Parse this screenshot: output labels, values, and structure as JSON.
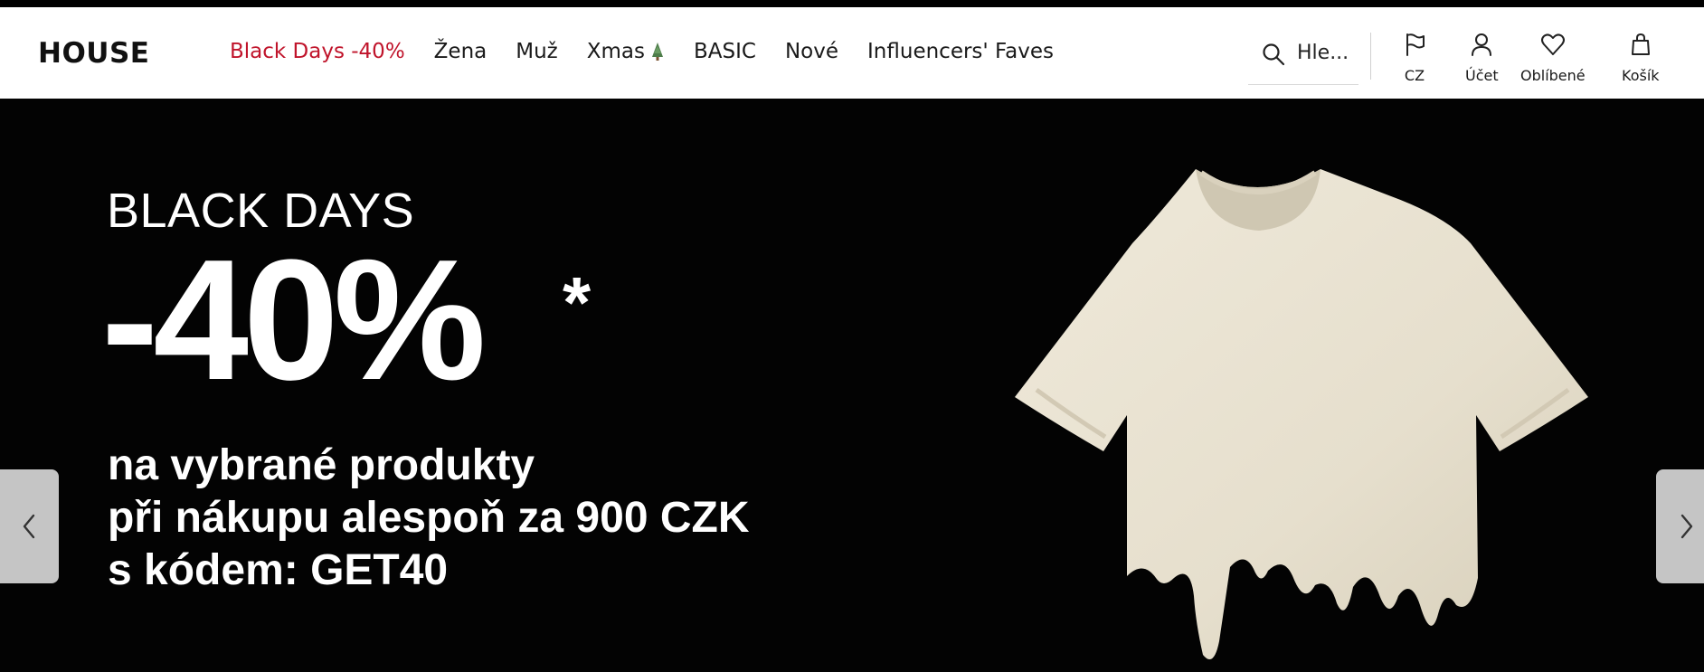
{
  "brand": {
    "logo_text": "HOUSE"
  },
  "nav": {
    "items": [
      {
        "label": "Black Days -40%",
        "promo": true
      },
      {
        "label": "Žena"
      },
      {
        "label": "Muž"
      },
      {
        "label": "Xmas",
        "icon": "christmas-tree-icon"
      },
      {
        "label": "BASIC"
      },
      {
        "label": "Nové"
      },
      {
        "label": "Influencers' Faves"
      }
    ]
  },
  "search": {
    "placeholder": "Hle...",
    "icon": "search-icon"
  },
  "utilities": {
    "country": {
      "label": "CZ",
      "icon": "flag-icon"
    },
    "account": {
      "label": "Účet",
      "icon": "user-icon"
    },
    "favorites": {
      "label": "Oblíbené",
      "icon": "heart-icon"
    },
    "cart": {
      "label": "Košík",
      "icon": "bag-icon"
    }
  },
  "hero": {
    "kicker": "BLACK DAYS",
    "discount": "-40%",
    "asterisk": "*",
    "line1": "na vybrané produkty",
    "line2": "při nákupu alespoň za 900 CZK",
    "line3": "s kódem: GET40",
    "image": "cream-tshirt-melting"
  },
  "carousel": {
    "prev_icon": "chevron-left-icon",
    "next_icon": "chevron-right-icon"
  },
  "colors": {
    "promo": "#c0142b",
    "hero_bg": "#030303",
    "text": "#1a1a1a",
    "tshirt": "#e8e2d2"
  }
}
